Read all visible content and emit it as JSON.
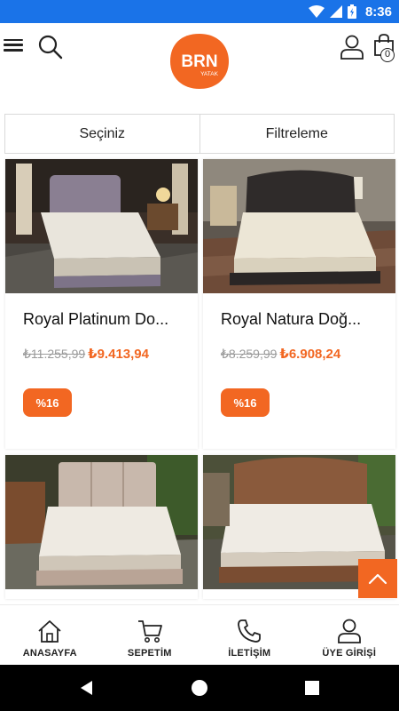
{
  "status_bar": {
    "time": "8:36"
  },
  "header": {
    "logo": {
      "brand": "BRN",
      "subtitle": "YATAK"
    },
    "cart_count": "0"
  },
  "filter_bar": {
    "sort_label": "Seçiniz",
    "filter_label": "Filtreleme"
  },
  "products": [
    {
      "title": "Royal Platinum Dolgulu Yatak",
      "display_title": "Royal Platinum Do...",
      "old_price": "₺11.255,99",
      "new_price": "₺9.413,94",
      "discount": "%16"
    },
    {
      "title": "Royal Natura Doğal Yatak",
      "display_title": "Royal Natura Doğ...",
      "old_price": "₺8.259,99",
      "new_price": "₺6.908,24",
      "discount": "%16"
    },
    {
      "title": "",
      "display_title": ""
    },
    {
      "title": "",
      "display_title": ""
    }
  ],
  "bottom_nav": {
    "home": "ANASAYFA",
    "cart": "SEPETİM",
    "contact": "İLETİŞİM",
    "login": "ÜYE GİRİŞİ"
  },
  "colors": {
    "accent": "#f26722",
    "status_bar": "#1a73e8"
  }
}
